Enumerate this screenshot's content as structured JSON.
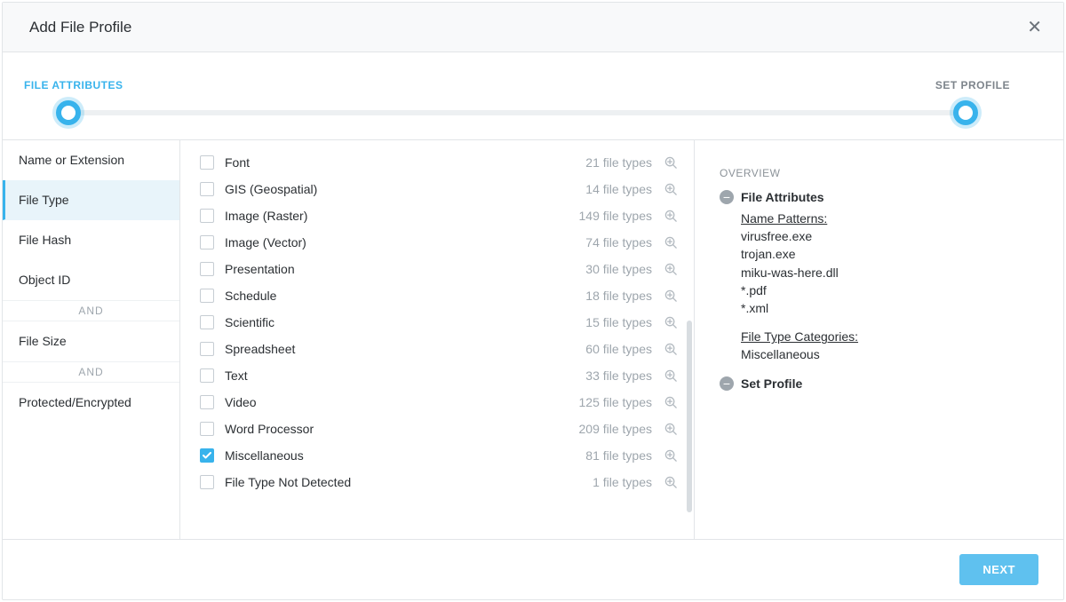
{
  "modal": {
    "title": "Add File Profile"
  },
  "stepper": {
    "step1": "FILE ATTRIBUTES",
    "step2": "SET PROFILE"
  },
  "sidebar": {
    "items": [
      {
        "label": "Name or Extension"
      },
      {
        "label": "File Type"
      },
      {
        "label": "File Hash"
      },
      {
        "label": "Object ID"
      }
    ],
    "and": "AND",
    "fileSize": "File Size",
    "protected": "Protected/Encrypted"
  },
  "fileTypes": [
    {
      "label": "Font",
      "count": "21 file types",
      "checked": false
    },
    {
      "label": "GIS (Geospatial)",
      "count": "14 file types",
      "checked": false
    },
    {
      "label": "Image (Raster)",
      "count": "149 file types",
      "checked": false
    },
    {
      "label": "Image (Vector)",
      "count": "74 file types",
      "checked": false
    },
    {
      "label": "Presentation",
      "count": "30 file types",
      "checked": false
    },
    {
      "label": "Schedule",
      "count": "18 file types",
      "checked": false
    },
    {
      "label": "Scientific",
      "count": "15 file types",
      "checked": false
    },
    {
      "label": "Spreadsheet",
      "count": "60 file types",
      "checked": false
    },
    {
      "label": "Text",
      "count": "33 file types",
      "checked": false
    },
    {
      "label": "Video",
      "count": "125 file types",
      "checked": false
    },
    {
      "label": "Word Processor",
      "count": "209 file types",
      "checked": false
    },
    {
      "label": "Miscellaneous",
      "count": "81 file types",
      "checked": true
    },
    {
      "label": "File Type Not Detected",
      "count": "1 file types",
      "checked": false
    }
  ],
  "overview": {
    "title": "OVERVIEW",
    "fileAttributes": "File Attributes",
    "namePatternsLabel": "Name Patterns:",
    "namePatterns": [
      "virusfree.exe",
      "trojan.exe",
      "miku-was-here.dll",
      "*.pdf",
      "*.xml"
    ],
    "fileTypeCatLabel": "File Type Categories:",
    "fileTypeCat": "Miscellaneous",
    "setProfile": "Set Profile"
  },
  "footer": {
    "next": "NEXT"
  }
}
